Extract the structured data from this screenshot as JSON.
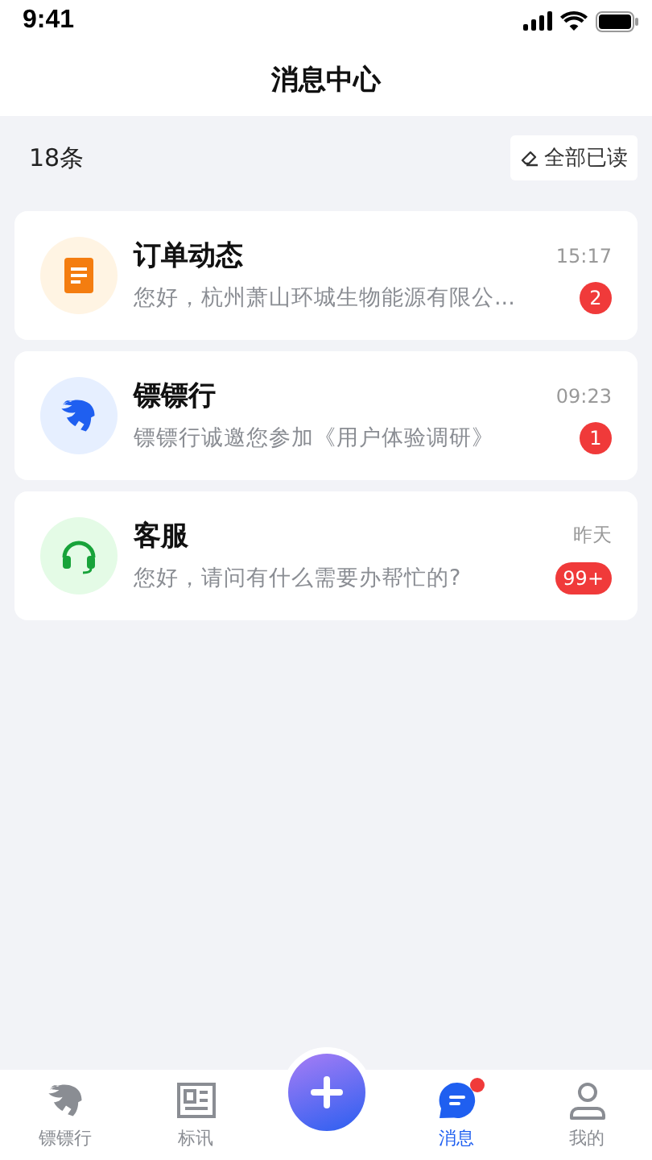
{
  "status_bar": {
    "time": "9:41"
  },
  "header": {
    "title": "消息中心"
  },
  "summary": {
    "count": "18条",
    "mark_all_read": "全部已读"
  },
  "conversations": [
    {
      "kind": "order",
      "title": "订单动态",
      "preview": "您好，杭州萧山环城生物能源有限公...",
      "time": "15:17",
      "badge": "2"
    },
    {
      "kind": "brand",
      "title": "镖镖行",
      "preview": "镖镖行诚邀您参加《用户体验调研》",
      "time": "09:23",
      "badge": "1"
    },
    {
      "kind": "service",
      "title": "客服",
      "preview": "您好，请问有什么需要办帮忙的?",
      "time": "昨天",
      "badge": "99+"
    }
  ],
  "tab_bar": [
    {
      "kind": "brand",
      "label": "镖镖行",
      "selected": false,
      "dot": false
    },
    {
      "kind": "news",
      "label": "标讯",
      "selected": false,
      "dot": false
    },
    {
      "kind": "add"
    },
    {
      "kind": "message",
      "label": "消息",
      "selected": true,
      "dot": true
    },
    {
      "kind": "profile",
      "label": "我的",
      "selected": false,
      "dot": false
    }
  ]
}
